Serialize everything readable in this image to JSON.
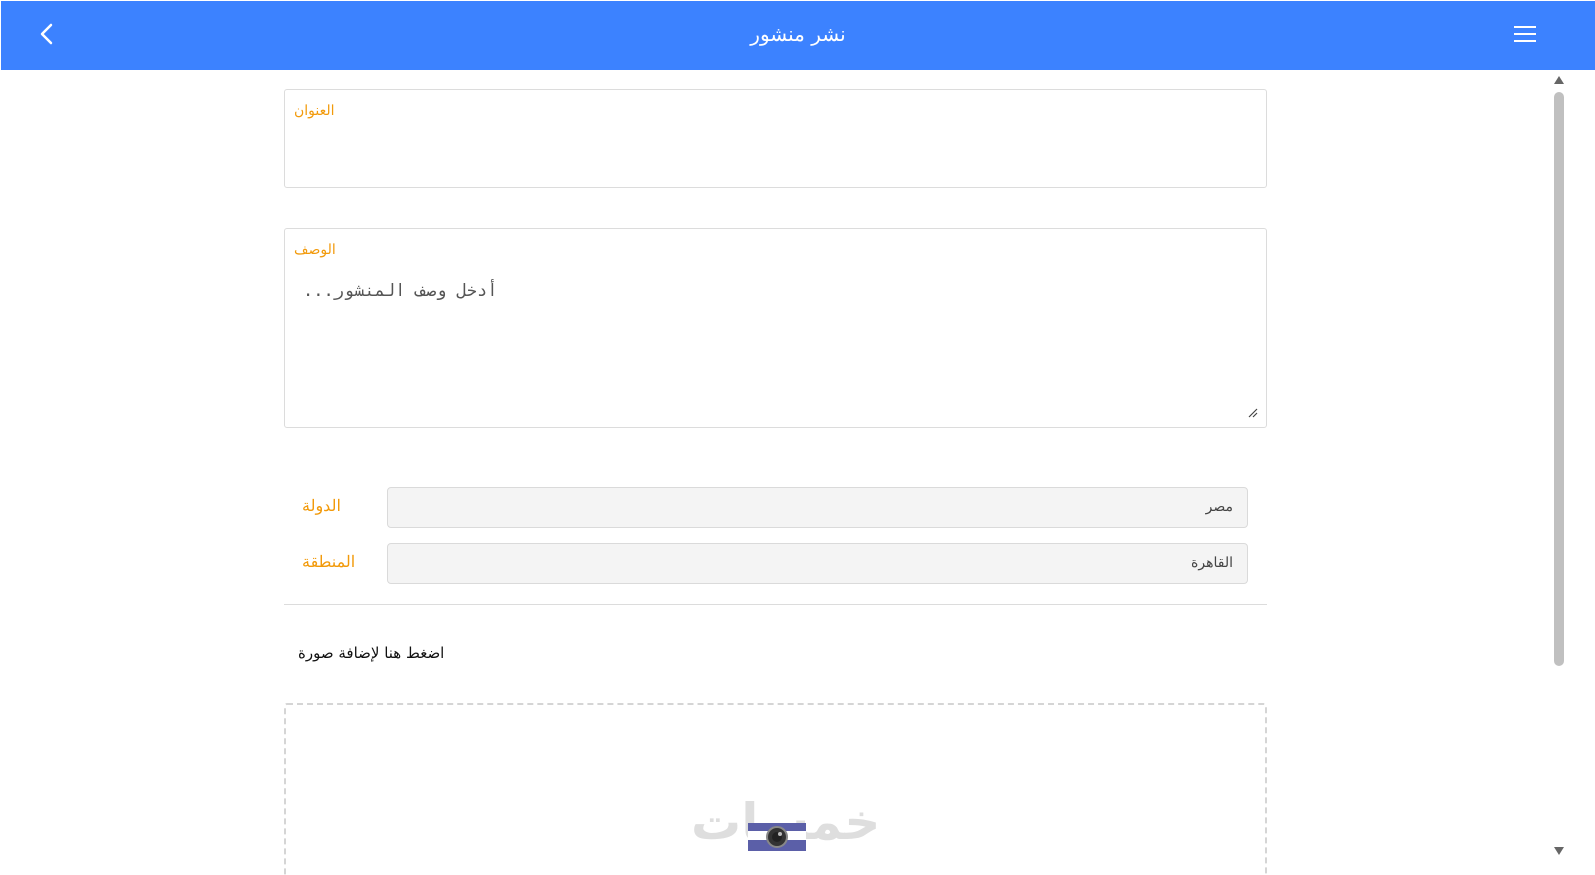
{
  "header": {
    "title": "نشر منشور",
    "back_icon": "chevron-left-icon",
    "menu_icon": "hamburger-menu-icon",
    "background_color": "#3c82ff"
  },
  "form": {
    "title_field": {
      "label": "العنوان",
      "value": ""
    },
    "description_field": {
      "label": "الوصف",
      "placeholder": "...أدخل وصف المنشور"
    },
    "country": {
      "label": "الدولة",
      "selected": "مصر"
    },
    "region": {
      "label": "المنطقة",
      "selected": "القاهرة"
    },
    "add_photo_text": "اضغط هنا لإضافة صورة",
    "label_color": "#f29a0b"
  },
  "dropzone": {
    "watermark_text": "خمسات",
    "icon": "camera-icon"
  }
}
